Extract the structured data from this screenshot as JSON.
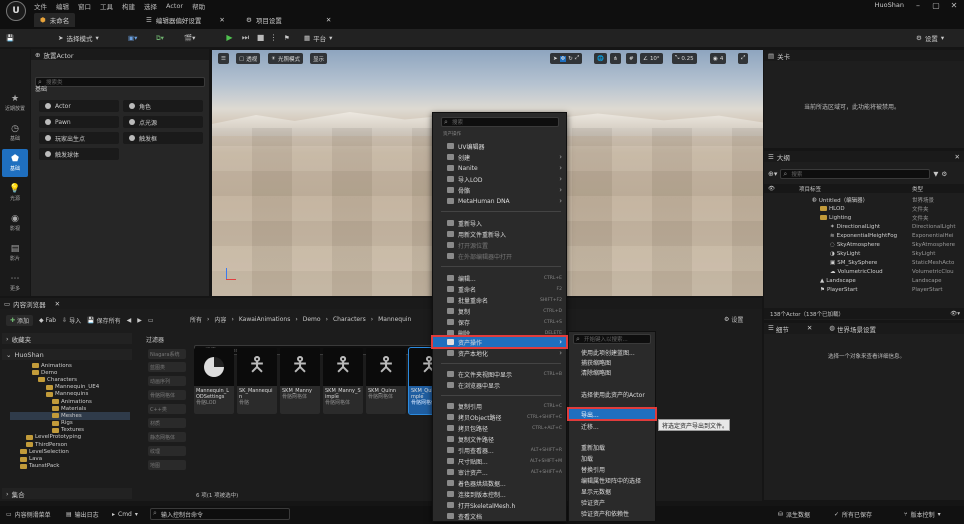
{
  "menubar": {
    "items": [
      "文件",
      "编辑",
      "窗口",
      "工具",
      "构建",
      "选择",
      "Actor",
      "帮助"
    ],
    "user": "HuoShan"
  },
  "tabs": {
    "level": "未命名",
    "prefs": "编辑器偏好设置",
    "project": "项目设置"
  },
  "toolbar": {
    "mode": "选择模式",
    "platform": "平台",
    "settings": "设置"
  },
  "leftnav": [
    {
      "label": "近期放置",
      "icon": "star-icon"
    },
    {
      "label": "基础",
      "icon": "clock-icon"
    },
    {
      "label": "基础",
      "icon": "shapes-icon"
    },
    {
      "label": "光源",
      "icon": "light-icon"
    },
    {
      "label": "影视",
      "icon": "camera-icon"
    },
    {
      "label": "影片",
      "icon": "film-icon"
    },
    {
      "label": "更多",
      "icon": "more-icon"
    }
  ],
  "place": {
    "title": "放置Actor",
    "search_placeholder": "搜索类",
    "section": "基础",
    "items": [
      "Actor",
      "角色",
      "Pawn",
      "点光源",
      "玩家出生点",
      "触发框",
      "触发球体"
    ]
  },
  "viewport": {
    "perspective": "透视",
    "lit": "光照模式",
    "show": "显示",
    "grid_angle": "10°",
    "scale": "0.25",
    "speed": "4"
  },
  "details_top": {
    "title": "关卡",
    "message": "当前所选区域可，此功能将被禁用。"
  },
  "outliner": {
    "title": "大纲",
    "search_placeholder": "搜索",
    "col_label": "项目标签",
    "col_type": "类型",
    "rows": [
      {
        "label": "Untitled（编辑器）",
        "type": "世界场景"
      },
      {
        "label": "HLOD",
        "type": "文件夹"
      },
      {
        "label": "Lighting",
        "type": "文件夹"
      },
      {
        "label": "DirectionalLight",
        "type": "DirectionalLight"
      },
      {
        "label": "ExponentialHeightFog",
        "type": "ExponentialHei"
      },
      {
        "label": "SkyAtmosphere",
        "type": "SkyAtmosphere"
      },
      {
        "label": "SkyLight",
        "type": "SkyLight"
      },
      {
        "label": "SM_SkySphere",
        "type": "StaticMeshActo"
      },
      {
        "label": "VolumetricCloud",
        "type": "VolumetricClou"
      },
      {
        "label": "Landscape",
        "type": "Landscape"
      },
      {
        "label": "PlayerStart",
        "type": "PlayerStart"
      }
    ],
    "count": "138个Actor（138个已加载）"
  },
  "details": {
    "tab1": "细节",
    "tab2": "世界场景设置",
    "message": "选择一个对象来查看详细信息。"
  },
  "content": {
    "title": "内容浏览器",
    "add": "添加",
    "fab": "Fab",
    "import": "导入",
    "save_all": "保存所有",
    "path": [
      "所有",
      "内容",
      "KawaiAnimations",
      "Demo",
      "Characters",
      "Mannequin"
    ],
    "settings": "设置",
    "favorites": "收藏夹",
    "project": "HuoShan",
    "collections": "集合",
    "filters_title": "过滤器",
    "search_placeholder": "搜索 Meshes",
    "status": "6 项(1 项被选中)",
    "tree": [
      "Animations",
      "Demo",
      "Characters",
      "Mannequin_UE4",
      "Mannequins",
      "Animations",
      "Materials",
      "Meshes",
      "Rigs",
      "Textures",
      "LevelPrototyping",
      "ThirdPerson",
      "LevelSelection",
      "Lava",
      "TaunstPack"
    ],
    "filters": [
      "Niagara系统",
      "蓝图类",
      "动画序列",
      "骨骼网格体",
      "C++类",
      "材质",
      "静态网格体",
      "纹理",
      "地图"
    ],
    "assets": [
      {
        "name": "Mannequin_LODSettings",
        "type": "骨骼LOD"
      },
      {
        "name": "SK_Mannequin",
        "type": "骨骼"
      },
      {
        "name": "SKM_Manny",
        "type": "骨骼网格体"
      },
      {
        "name": "SKM_Manny_Simple",
        "type": "骨骼网格体"
      },
      {
        "name": "SKM_Quinn",
        "type": "骨骼网格体"
      },
      {
        "name": "SKM_Quinn_Simple",
        "type": "骨骼网格体"
      }
    ]
  },
  "context_menu": {
    "search_placeholder": "搜索",
    "section1": "资产操作",
    "items": [
      {
        "label": "UV编辑器",
        "sc": ""
      },
      {
        "label": "创建",
        "sc": "",
        "arrow": true
      },
      {
        "label": "Nanite",
        "sc": "",
        "arrow": true
      },
      {
        "label": "导入LOD",
        "sc": "",
        "arrow": true
      },
      {
        "label": "骨骼",
        "sc": "",
        "arrow": true
      },
      {
        "label": "MetaHuman DNA",
        "sc": "",
        "arrow": true
      },
      {
        "label": "重新导入",
        "sc": ""
      },
      {
        "label": "用新文件重新导入",
        "sc": ""
      },
      {
        "label": "打开源位置",
        "sc": "",
        "dis": true
      },
      {
        "label": "在外部编辑器中打开",
        "sc": "",
        "dis": true
      },
      {
        "label": "编辑...",
        "sc": "CTRL+E"
      },
      {
        "label": "重命名",
        "sc": "F2"
      },
      {
        "label": "批量重命名",
        "sc": "SHIFT+F2"
      },
      {
        "label": "复制",
        "sc": "CTRL+D"
      },
      {
        "label": "保存",
        "sc": "CTRL+S"
      },
      {
        "label": "删除",
        "sc": "DELETE"
      },
      {
        "label": "资产操作",
        "sc": "",
        "arrow": true,
        "hl": true
      },
      {
        "label": "资产本地化",
        "sc": "",
        "arrow": true
      },
      {
        "label": "在文件夹视图中显示",
        "sc": "CTRL+B"
      },
      {
        "label": "在浏览器中显示",
        "sc": ""
      },
      {
        "label": "复制引用",
        "sc": "CTRL+C"
      },
      {
        "label": "拷贝Object路径",
        "sc": "CTRL+SHIFT+C"
      },
      {
        "label": "拷贝包路径",
        "sc": "CTRL+ALT+C"
      },
      {
        "label": "复制文件路径",
        "sc": ""
      },
      {
        "label": "引用查看器...",
        "sc": "ALT+SHIFT+R"
      },
      {
        "label": "尺寸贴图...",
        "sc": "ALT+SHIFT+M"
      },
      {
        "label": "审计资产...",
        "sc": "ALT+SHIFT+A"
      },
      {
        "label": "着色器烘焙数据...",
        "sc": ""
      },
      {
        "label": "连接到版本控制...",
        "sc": ""
      },
      {
        "label": "打开SkeletalMesh.h",
        "sc": ""
      },
      {
        "label": "查看文档",
        "sc": ""
      }
    ]
  },
  "submenu": {
    "search_placeholder": "开始键入以搜索...",
    "items": [
      "使用此项创建蓝图...",
      "捕获缩略图",
      "清除缩略图",
      "选择使用此资产的Actor",
      "导出...",
      "迁移...",
      "重新加载",
      "加载",
      "替换引用",
      "编辑属性矩阵中的选择",
      "显示元数据",
      "验证资产",
      "验证资产和依赖性"
    ]
  },
  "tooltip": "将选定资产导出到文件。",
  "statusbar": {
    "drawer": "内容侧滑菜单",
    "output": "输出日志",
    "cmd": "Cmd",
    "console_placeholder": "输入控制台命令",
    "derived": "派生数据",
    "saved": "所有已保存",
    "revision": "版本控制"
  },
  "accent": "#1f6fbf",
  "highlight": "#e03c3c"
}
